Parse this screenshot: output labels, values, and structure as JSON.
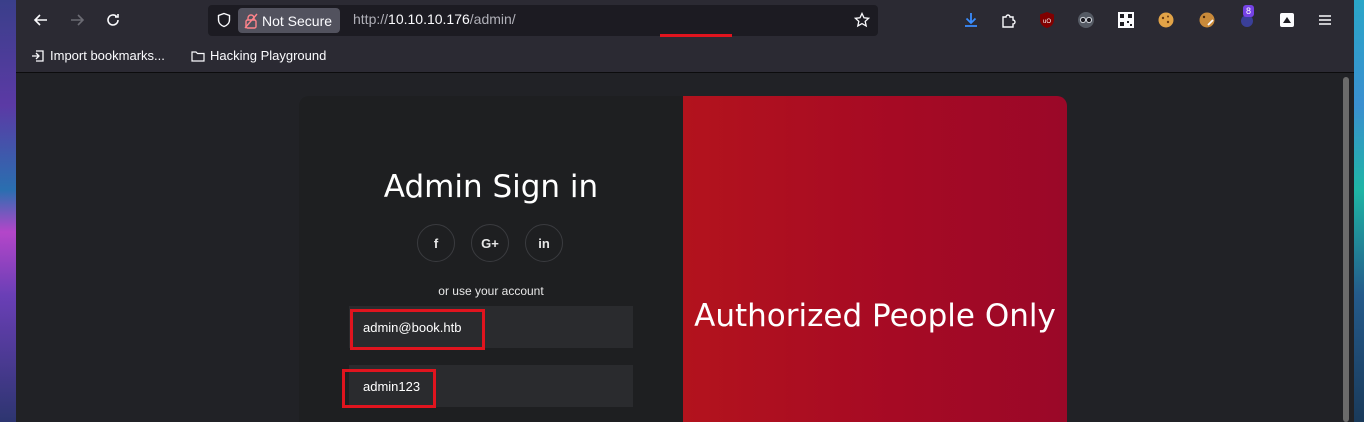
{
  "browser": {
    "url": {
      "scheme": "http://",
      "host": "10.10.10.176",
      "path": "/admin/"
    },
    "security_label": "Not Secure",
    "extension_badge": "8",
    "bookmarks": [
      {
        "label": "Import bookmarks...",
        "icon": "import-icon"
      },
      {
        "label": "Hacking Playground",
        "icon": "folder-icon"
      }
    ]
  },
  "page": {
    "title": "Admin Sign in",
    "social_buttons": [
      {
        "label": "f",
        "icon": "facebook-icon"
      },
      {
        "label": "G+",
        "icon": "google-plus-icon"
      },
      {
        "label": "in",
        "icon": "linkedin-icon"
      }
    ],
    "alt_text": "or use your account",
    "email_value": "admin@book.htb",
    "password_value": "admin123",
    "overlay_heading": "Authorized People Only"
  },
  "colors": {
    "accent_red": "#e0141e",
    "panel_red": "#a60a24"
  }
}
